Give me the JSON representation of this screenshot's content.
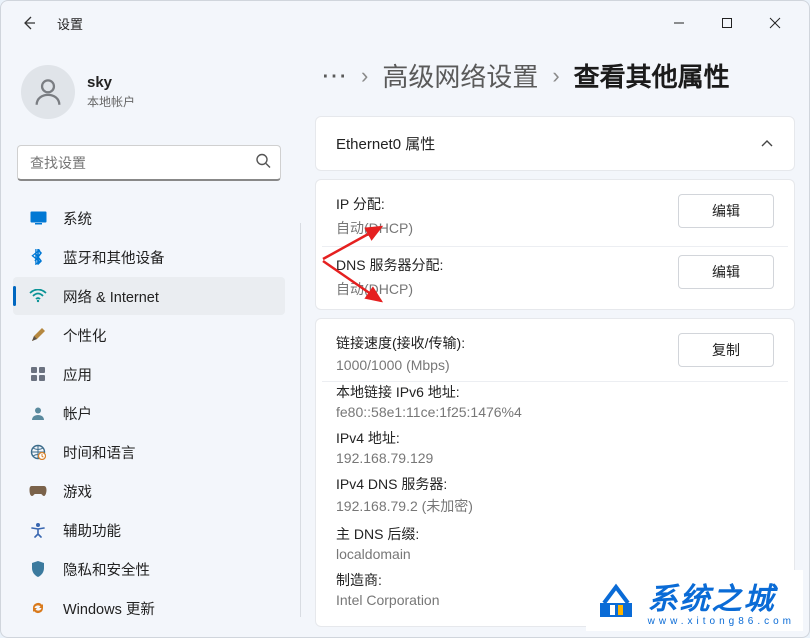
{
  "window": {
    "title": "设置"
  },
  "user": {
    "name": "sky",
    "subtitle": "本地帐户"
  },
  "search": {
    "placeholder": "查找设置"
  },
  "nav": {
    "items": [
      {
        "id": "system",
        "label": "系统",
        "icon": "💻"
      },
      {
        "id": "bluetooth",
        "label": "蓝牙和其他设备",
        "icon": "bt"
      },
      {
        "id": "network",
        "label": "网络 & Internet",
        "icon": "wifi"
      },
      {
        "id": "personalization",
        "label": "个性化",
        "icon": "✏️"
      },
      {
        "id": "apps",
        "label": "应用",
        "icon": "apps"
      },
      {
        "id": "accounts",
        "label": "帐户",
        "icon": "👤"
      },
      {
        "id": "time",
        "label": "时间和语言",
        "icon": "🌐"
      },
      {
        "id": "gaming",
        "label": "游戏",
        "icon": "🎮"
      },
      {
        "id": "accessibility",
        "label": "辅助功能",
        "icon": "acc"
      },
      {
        "id": "privacy",
        "label": "隐私和安全性",
        "icon": "🛡️"
      },
      {
        "id": "update",
        "label": "Windows 更新",
        "icon": "⟳"
      }
    ]
  },
  "breadcrumb": {
    "prev": "高级网络设置",
    "current": "查看其他属性"
  },
  "panel": {
    "title": "Ethernet0 属性",
    "rows": [
      {
        "label": "IP 分配:",
        "value": "自动(DHCP)",
        "action": "编辑"
      },
      {
        "label": "DNS 服务器分配:",
        "value": "自动(DHCP)",
        "action": "编辑"
      }
    ],
    "details_header": {
      "label": "链接速度(接收/传输):",
      "value": "1000/1000 (Mbps)",
      "action": "复制"
    },
    "details": [
      {
        "label": "本地链接 IPv6 地址:",
        "value": "fe80::58e1:11ce:1f25:1476%4"
      },
      {
        "label": "IPv4 地址:",
        "value": "192.168.79.129"
      },
      {
        "label": "IPv4 DNS 服务器:",
        "value": "192.168.79.2 (未加密)"
      },
      {
        "label": "主 DNS 后缀:",
        "value": "localdomain"
      },
      {
        "label": "制造商:",
        "value": "Intel Corporation"
      }
    ]
  },
  "watermark": {
    "text": "系统之城",
    "sub": "www.xitong86.com"
  }
}
